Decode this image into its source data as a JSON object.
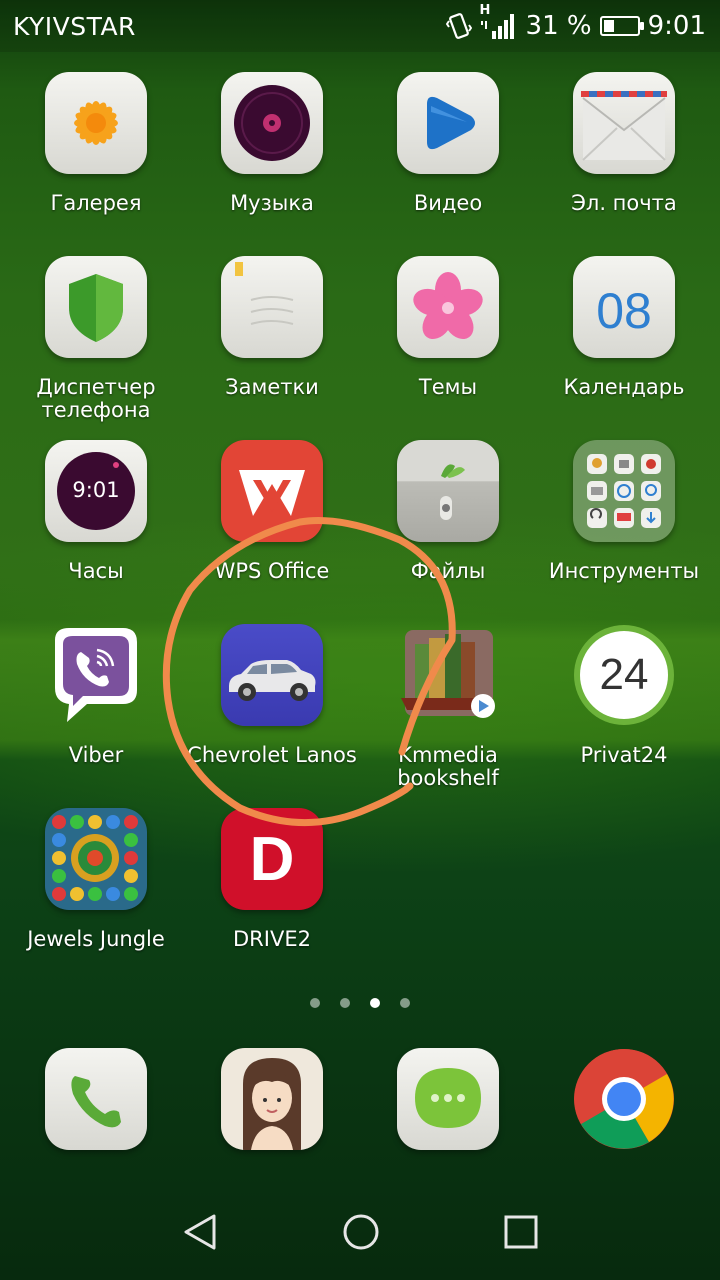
{
  "status": {
    "carrier": "KYIVSTAR",
    "network_type": "H",
    "battery_percent": "31 %",
    "battery_level": 0.31,
    "time": "9:01"
  },
  "apps": [
    {
      "label": "Галерея"
    },
    {
      "label": "Музыка"
    },
    {
      "label": "Видео"
    },
    {
      "label": "Эл. почта"
    },
    {
      "label": "Диспетчер\nтелефона"
    },
    {
      "label": "Заметки"
    },
    {
      "label": "Темы"
    },
    {
      "label": "Календарь",
      "icon_text": "08"
    },
    {
      "label": "Часы",
      "icon_text": "9:01"
    },
    {
      "label": "WPS Office"
    },
    {
      "label": "Файлы"
    },
    {
      "label": "Инструменты"
    },
    {
      "label": "Viber"
    },
    {
      "label": "Chevrolet Lanos"
    },
    {
      "label": "Kmmedia\nbookshelf"
    },
    {
      "label": "Privat24",
      "icon_text": "24"
    },
    {
      "label": "Jewels Jungle"
    },
    {
      "label": "DRIVE2",
      "icon_text": "D"
    }
  ],
  "page_indicator": {
    "count": 4,
    "active_index": 2
  },
  "dock": [
    {
      "name": "phone"
    },
    {
      "name": "contacts"
    },
    {
      "name": "messages"
    },
    {
      "name": "chrome"
    }
  ],
  "annotation_color": "#f08a4b"
}
